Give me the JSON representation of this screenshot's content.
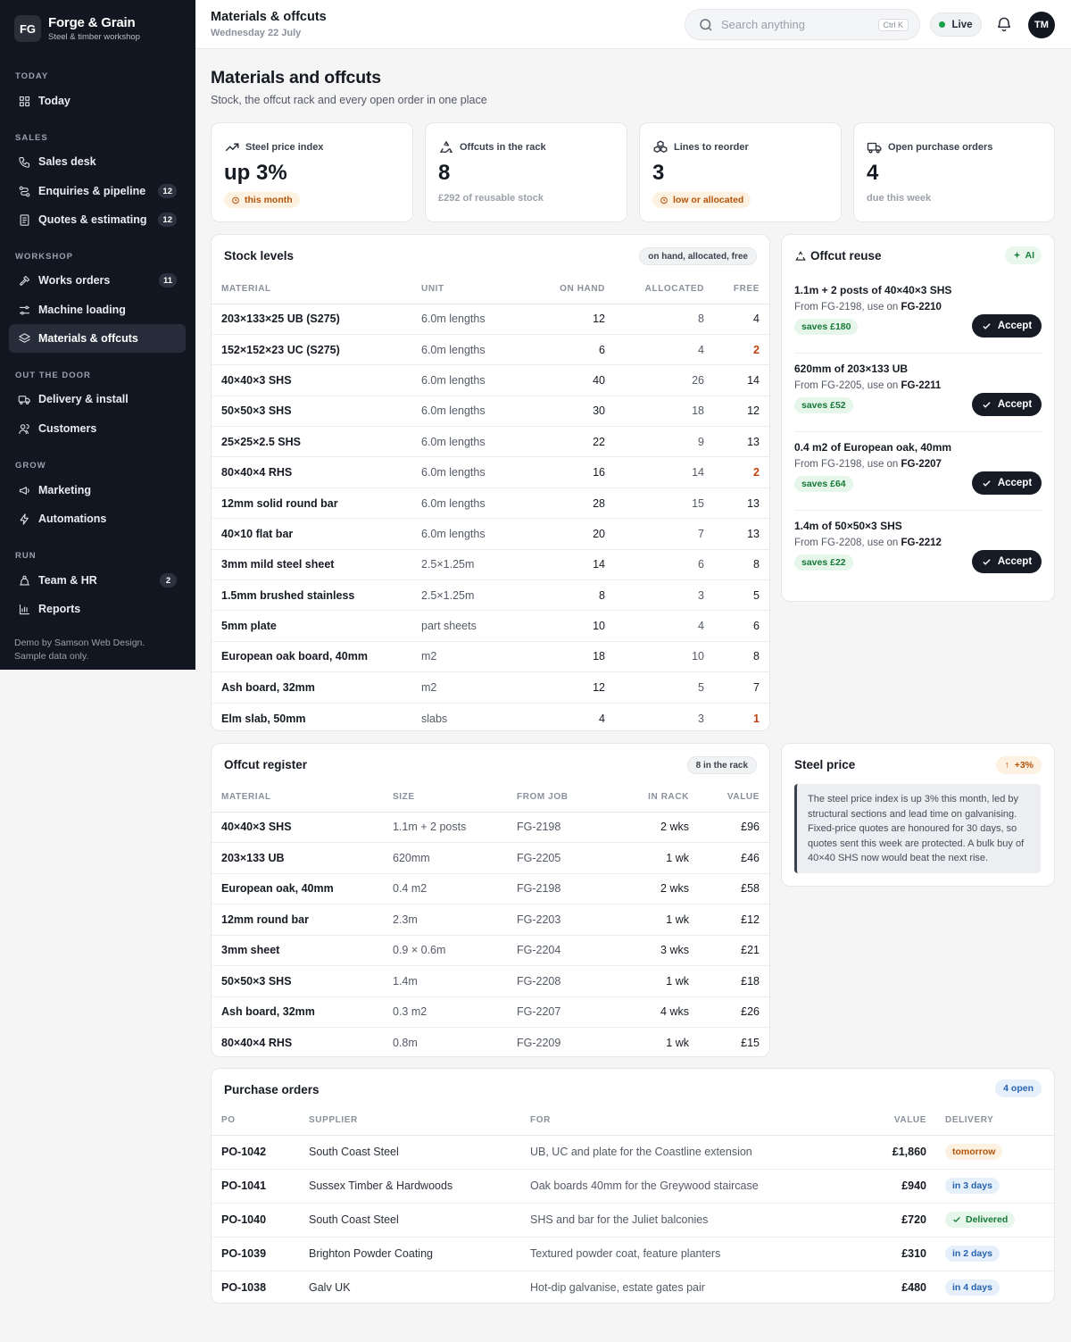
{
  "brand": {
    "logo": "FG",
    "name": "Forge & Grain",
    "tagline": "Steel & timber workshop"
  },
  "sidebar": {
    "sections": {
      "today": "TODAY",
      "sales": "SALES",
      "workshop": "WORKSHOP",
      "out_the_door": "OUT THE DOOR",
      "grow": "GROW",
      "run": "RUN"
    },
    "items": [
      {
        "label": "Today",
        "icon": "grid-icon"
      },
      {
        "label": "Sales desk",
        "icon": "phone-icon"
      },
      {
        "label": "Enquiries & pipeline",
        "icon": "pipeline-icon",
        "badge": "12"
      },
      {
        "label": "Quotes & estimating",
        "icon": "document-icon",
        "badge": "12"
      },
      {
        "label": "Works orders",
        "icon": "hammer-icon",
        "badge": "11"
      },
      {
        "label": "Machine loading",
        "icon": "sliders-icon"
      },
      {
        "label": "Materials & offcuts",
        "icon": "layers-icon",
        "active": true
      },
      {
        "label": "Delivery & install",
        "icon": "truck-icon"
      },
      {
        "label": "Customers",
        "icon": "users-icon"
      },
      {
        "label": "Marketing",
        "icon": "megaphone-icon"
      },
      {
        "label": "Automations",
        "icon": "bolt-icon"
      },
      {
        "label": "Team & HR",
        "icon": "team-icon",
        "badge": "2"
      },
      {
        "label": "Reports",
        "icon": "bar-chart-icon"
      }
    ],
    "footer": {
      "line1": "Demo by Samson Web Design.",
      "line2": "Sample data only."
    }
  },
  "topbar": {
    "title": "Materials & offcuts",
    "date": "Wednesday 22 July",
    "search_placeholder": "Search anything",
    "shortcut": "Ctrl K",
    "live": "Live",
    "avatar": "TM"
  },
  "page": {
    "title": "Materials and offcuts",
    "subtitle": "Stock, the offcut rack and every open order in one place"
  },
  "kpis": [
    {
      "label": "Steel price index",
      "value": "up 3%",
      "pill": "this month",
      "icon": "trend-up-icon"
    },
    {
      "label": "Offcuts in the rack",
      "value": "8",
      "note": "£292 of reusable stock",
      "icon": "recycle-icon"
    },
    {
      "label": "Lines to reorder",
      "value": "3",
      "pill": "low or allocated",
      "icon": "boxes-icon"
    },
    {
      "label": "Open purchase orders",
      "value": "4",
      "note": "due this week",
      "icon": "truck-icon"
    }
  ],
  "stock": {
    "title": "Stock levels",
    "tag": "on hand, allocated, free",
    "columns": [
      "MATERIAL",
      "UNIT",
      "ON HAND",
      "ALLOCATED",
      "FREE"
    ],
    "rows": [
      {
        "material": "203×133×25 UB (S275)",
        "unit": "6.0m lengths",
        "on_hand": "12",
        "allocated": "8",
        "free": "4",
        "low": false
      },
      {
        "material": "152×152×23 UC (S275)",
        "unit": "6.0m lengths",
        "on_hand": "6",
        "allocated": "4",
        "free": "2",
        "low": true
      },
      {
        "material": "40×40×3 SHS",
        "unit": "6.0m lengths",
        "on_hand": "40",
        "allocated": "26",
        "free": "14",
        "low": false
      },
      {
        "material": "50×50×3 SHS",
        "unit": "6.0m lengths",
        "on_hand": "30",
        "allocated": "18",
        "free": "12",
        "low": false
      },
      {
        "material": "25×25×2.5 SHS",
        "unit": "6.0m lengths",
        "on_hand": "22",
        "allocated": "9",
        "free": "13",
        "low": false
      },
      {
        "material": "80×40×4 RHS",
        "unit": "6.0m lengths",
        "on_hand": "16",
        "allocated": "14",
        "free": "2",
        "low": true
      },
      {
        "material": "12mm solid round bar",
        "unit": "6.0m lengths",
        "on_hand": "28",
        "allocated": "15",
        "free": "13",
        "low": false
      },
      {
        "material": "40×10 flat bar",
        "unit": "6.0m lengths",
        "on_hand": "20",
        "allocated": "7",
        "free": "13",
        "low": false
      },
      {
        "material": "3mm mild steel sheet",
        "unit": "2.5×1.25m",
        "on_hand": "14",
        "allocated": "6",
        "free": "8",
        "low": false
      },
      {
        "material": "1.5mm brushed stainless",
        "unit": "2.5×1.25m",
        "on_hand": "8",
        "allocated": "3",
        "free": "5",
        "low": false
      },
      {
        "material": "5mm plate",
        "unit": "part sheets",
        "on_hand": "10",
        "allocated": "4",
        "free": "6",
        "low": false
      },
      {
        "material": "European oak board, 40mm",
        "unit": "m2",
        "on_hand": "18",
        "allocated": "10",
        "free": "8",
        "low": false
      },
      {
        "material": "Ash board, 32mm",
        "unit": "m2",
        "on_hand": "12",
        "allocated": "5",
        "free": "7",
        "low": false
      },
      {
        "material": "Elm slab, 50mm",
        "unit": "slabs",
        "on_hand": "4",
        "allocated": "3",
        "free": "1",
        "low": true
      }
    ]
  },
  "reuse": {
    "title": "Offcut reuse",
    "ai": "AI",
    "accept_label": "Accept",
    "items": [
      {
        "title": "1.1m + 2 posts of 40×40×3 SHS",
        "from": "From FG-2198, use on",
        "job": "FG-2210",
        "saves": "saves £180"
      },
      {
        "title": "620mm of 203×133 UB",
        "from": "From FG-2205, use on",
        "job": "FG-2211",
        "saves": "saves £52"
      },
      {
        "title": "0.4 m2 of European oak, 40mm",
        "from": "From FG-2198, use on",
        "job": "FG-2207",
        "saves": "saves £64"
      },
      {
        "title": "1.4m of 50×50×3 SHS",
        "from": "From FG-2208, use on",
        "job": "FG-2212",
        "saves": "saves £22"
      }
    ]
  },
  "register": {
    "title": "Offcut register",
    "tag": "8 in the rack",
    "columns": [
      "MATERIAL",
      "SIZE",
      "FROM JOB",
      "IN RACK",
      "VALUE"
    ],
    "rows": [
      {
        "material": "40×40×3 SHS",
        "size": "1.1m + 2 posts",
        "job": "FG-2198",
        "rack": "2 wks",
        "value": "£96"
      },
      {
        "material": "203×133 UB",
        "size": "620mm",
        "job": "FG-2205",
        "rack": "1 wk",
        "value": "£46"
      },
      {
        "material": "European oak, 40mm",
        "size": "0.4 m2",
        "job": "FG-2198",
        "rack": "2 wks",
        "value": "£58"
      },
      {
        "material": "12mm round bar",
        "size": "2.3m",
        "job": "FG-2203",
        "rack": "1 wk",
        "value": "£12"
      },
      {
        "material": "3mm sheet",
        "size": "0.9 × 0.6m",
        "job": "FG-2204",
        "rack": "3 wks",
        "value": "£21"
      },
      {
        "material": "50×50×3 SHS",
        "size": "1.4m",
        "job": "FG-2208",
        "rack": "1 wk",
        "value": "£18"
      },
      {
        "material": "Ash board, 32mm",
        "size": "0.3 m2",
        "job": "FG-2207",
        "rack": "4 wks",
        "value": "£26"
      },
      {
        "material": "80×40×4 RHS",
        "size": "0.8m",
        "job": "FG-2209",
        "rack": "1 wk",
        "value": "£15"
      }
    ]
  },
  "steel": {
    "title": "Steel price",
    "change": "+3%",
    "note": "The steel price index is up 3% this month, led by structural sections and lead time on galvanising. Fixed-price quotes are honoured for 30 days, so quotes sent this week are protected. A bulk buy of 40×40 SHS now would beat the next rise."
  },
  "orders": {
    "title": "Purchase orders",
    "tag": "4 open",
    "columns": [
      "PO",
      "SUPPLIER",
      "FOR",
      "VALUE",
      "DELIVERY"
    ],
    "rows": [
      {
        "po": "PO-1042",
        "supplier": "South Coast Steel",
        "for": "UB, UC and plate for the Coastline extension",
        "value": "£1,860",
        "delivery": "tomorrow",
        "tone": "amber"
      },
      {
        "po": "PO-1041",
        "supplier": "Sussex Timber & Hardwoods",
        "for": "Oak boards 40mm for the Greywood staircase",
        "value": "£940",
        "delivery": "in 3 days",
        "tone": "blue"
      },
      {
        "po": "PO-1040",
        "supplier": "South Coast Steel",
        "for": "SHS and bar for the Juliet balconies",
        "value": "£720",
        "delivery": "Delivered",
        "tone": "green"
      },
      {
        "po": "PO-1039",
        "supplier": "Brighton Powder Coating",
        "for": "Textured powder coat, feature planters",
        "value": "£310",
        "delivery": "in 2 days",
        "tone": "blue"
      },
      {
        "po": "PO-1038",
        "supplier": "Galv UK",
        "for": "Hot-dip galvanise, estate gates pair",
        "value": "£480",
        "delivery": "in 4 days",
        "tone": "blue"
      }
    ]
  }
}
